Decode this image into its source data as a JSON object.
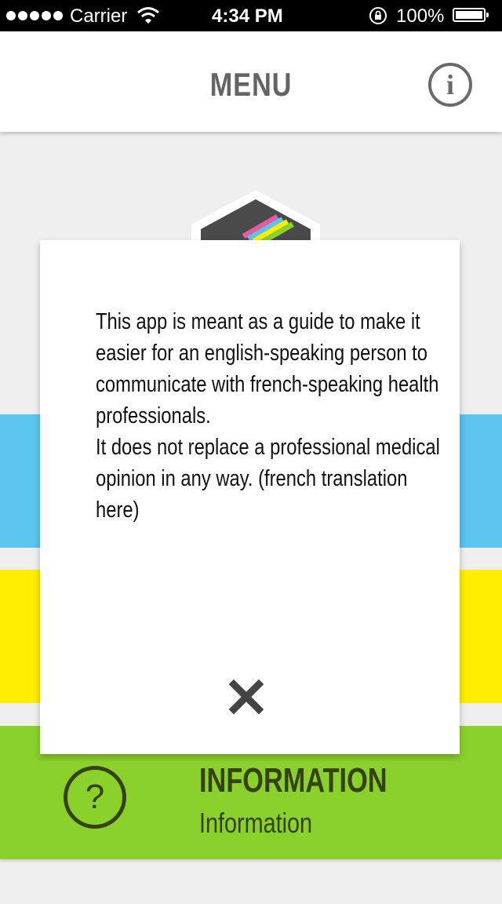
{
  "status_bar": {
    "carrier": "Carrier",
    "time": "4:34 PM",
    "battery": "100%"
  },
  "nav": {
    "title": "MENU",
    "info_glyph": "i"
  },
  "modal": {
    "paragraphs": [
      "This app is meant as a guide to make it easier for an english-speaking person to communicate with french-speaking health professionals.",
      "It does not replace a professional medical opinion in any way. (french translation here)"
    ]
  },
  "menu": {
    "information": {
      "title": "INFORMATION",
      "subtitle": "Information",
      "icon_glyph": "?"
    }
  },
  "colors": {
    "blue_band": "#5bc4ef",
    "yellow_band": "#ffee00",
    "green_band": "#8bd12b",
    "dark_text": "#35420f"
  },
  "icons": [
    "signal-icon",
    "wifi-icon",
    "lock-icon",
    "battery-icon",
    "info-icon",
    "close-icon",
    "help-icon",
    "app-logo-icon"
  ]
}
